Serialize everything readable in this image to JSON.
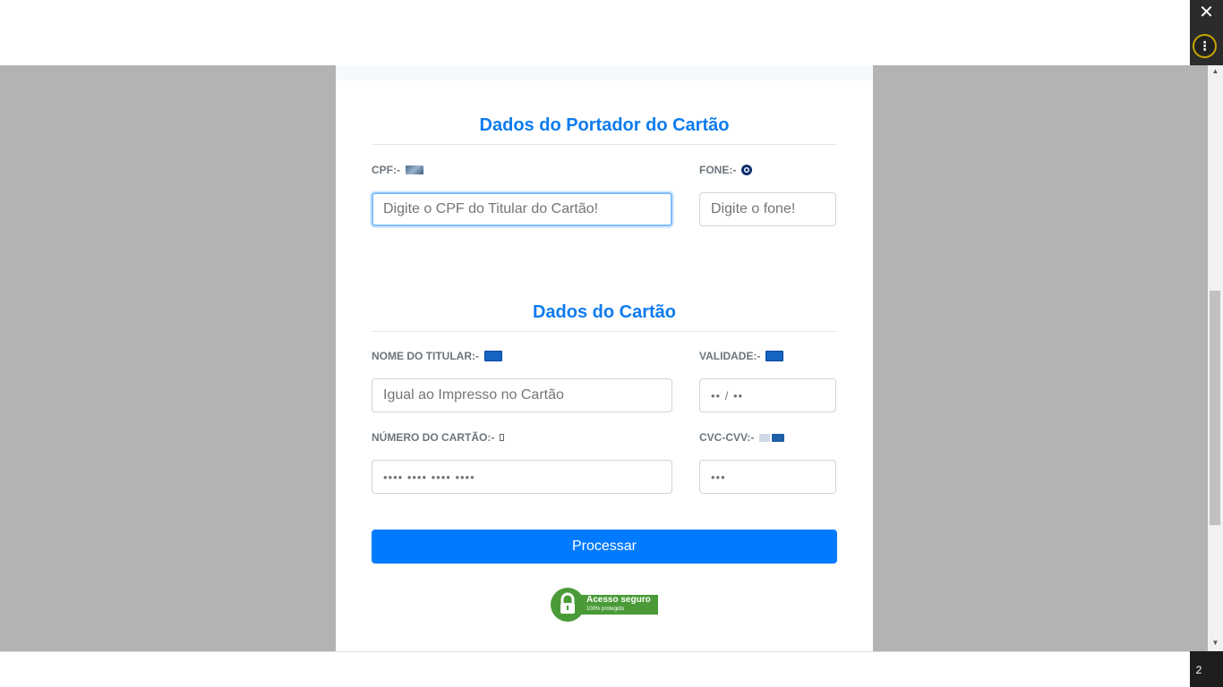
{
  "window": {
    "close_glyph": "✕",
    "menu_glyph": "⋮",
    "notification_count": "2"
  },
  "holder_section": {
    "title": "Dados do Portador do Cartão",
    "cpf_label": "CPF:-",
    "cpf_icon": "id-card-icon",
    "cpf_placeholder": "Digite o CPF do Titular do Cartão!",
    "phone_label": "FONE:-",
    "phone_icon": "whatsapp-icon",
    "phone_placeholder": "Digite o fone!"
  },
  "card_section": {
    "title": "Dados do Cartão",
    "name_label": "NOME DO TITULAR:-",
    "name_icon": "card-icon",
    "name_placeholder": "Igual ao Impresso no Cartão",
    "expiry_label": "VALIDADE:-",
    "expiry_icon": "card-icon",
    "expiry_placeholder": "•• / ••",
    "number_label": "NÚMERO DO CARTÃO:-",
    "number_icon": "broken-image-icon",
    "number_placeholder": "•••• •••• •••• ••••",
    "cvc_label": "CVC-CVV:-",
    "cvc_icon": "card-back-icon",
    "cvc_placeholder": "•••"
  },
  "submit_label": "Processar",
  "secure_badge": {
    "title": "Acesso seguro",
    "subtitle": "100% protegido"
  },
  "colors": {
    "accent": "#007bff",
    "title": "#0d7bf0",
    "secure_green": "#4a9b38"
  }
}
